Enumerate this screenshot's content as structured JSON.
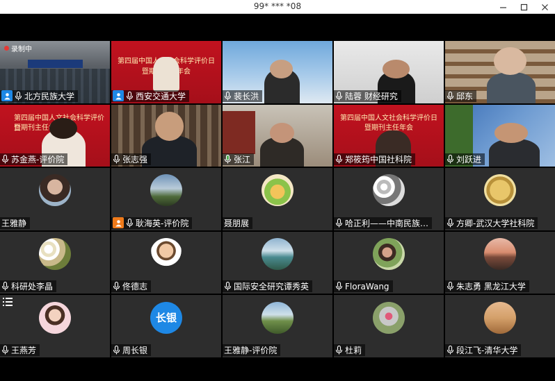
{
  "window": {
    "title": "99* *** *08"
  },
  "recording": {
    "label": "录制中"
  },
  "banner": {
    "line1": "第四届中国人文社会科学评价日",
    "line2": "暨期刊主任年会"
  },
  "participants": [
    {
      "name": "北方民族大学",
      "type": "video",
      "badge": "host"
    },
    {
      "name": "西安交通大学",
      "type": "video",
      "badge": "host"
    },
    {
      "name": "裴长洪",
      "type": "video"
    },
    {
      "name": "陆蓉 财经研究",
      "type": "video"
    },
    {
      "name": "邱东",
      "type": "video"
    },
    {
      "name": "苏金燕-评价院",
      "type": "video"
    },
    {
      "name": "张志强",
      "type": "video"
    },
    {
      "name": "张江",
      "type": "video",
      "mic": "active"
    },
    {
      "name": "郑筱筠中国社科院",
      "type": "video"
    },
    {
      "name": "刘跃进",
      "type": "video"
    },
    {
      "name": "王雅静",
      "type": "avatar"
    },
    {
      "name": "耿海英-评价院",
      "type": "avatar",
      "badge": "orange"
    },
    {
      "name": "聂朋展",
      "type": "avatar"
    },
    {
      "name": "哈正利——中南民族…",
      "type": "avatar"
    },
    {
      "name": "方卿-武汉大学社科院",
      "type": "avatar"
    },
    {
      "name": "科研处李晶",
      "type": "avatar"
    },
    {
      "name": "佟德志",
      "type": "avatar"
    },
    {
      "name": "国际安全研究谭秀英",
      "type": "avatar"
    },
    {
      "name": "FloraWang",
      "type": "avatar"
    },
    {
      "name": "朱志勇 黑龙江大学",
      "type": "avatar"
    },
    {
      "name": "王燕芳",
      "type": "avatar"
    },
    {
      "name": "周长银",
      "type": "avatar",
      "avatar_text": "长银"
    },
    {
      "name": "王雅静-评价院",
      "type": "avatar"
    },
    {
      "name": "杜莉",
      "type": "avatar"
    },
    {
      "name": "段江飞-清华大学",
      "type": "avatar"
    }
  ],
  "colors": {
    "accent": "#1e88e5",
    "badge_orange": "#ef7a1a",
    "mic_active": "#4caf50"
  }
}
